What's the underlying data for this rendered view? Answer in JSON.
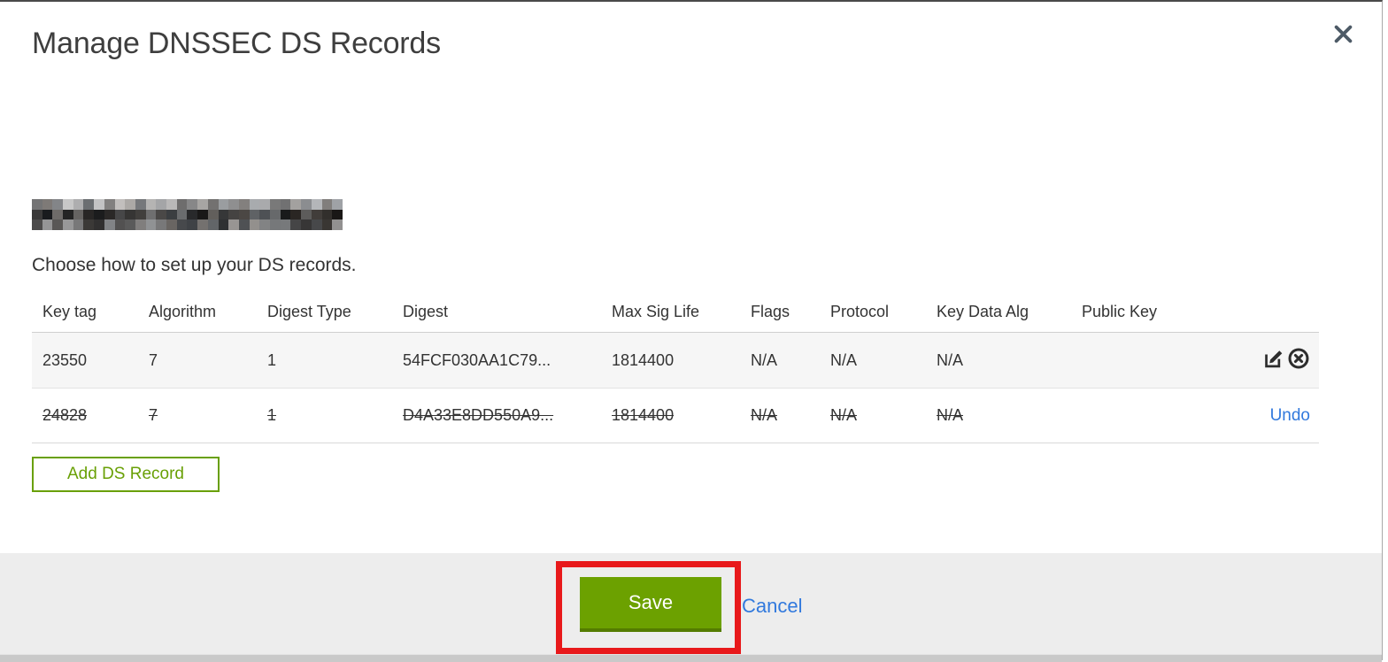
{
  "window": {
    "title": "Manage DNSSEC DS Records"
  },
  "content": {
    "instruction": "Choose how to set up your DS records.",
    "add_button_label": "Add DS Record",
    "domain_redacted": true
  },
  "table": {
    "columns": [
      "Key tag",
      "Algorithm",
      "Digest Type",
      "Digest",
      "Max Sig Life",
      "Flags",
      "Protocol",
      "Key Data Alg",
      "Public Key"
    ],
    "rows": [
      {
        "key_tag": "23550",
        "algorithm": "7",
        "digest_type": "1",
        "digest": "54FCF030AA1C79...",
        "max_sig_life": "1814400",
        "flags": "N/A",
        "protocol": "N/A",
        "key_data_alg": "N/A",
        "public_key": "",
        "state": "active",
        "actions": [
          "edit",
          "delete"
        ]
      },
      {
        "key_tag": "24828",
        "algorithm": "7",
        "digest_type": "1",
        "digest": "D4A33E8DD550A9...",
        "max_sig_life": "1814400",
        "flags": "N/A",
        "protocol": "N/A",
        "key_data_alg": "N/A",
        "public_key": "",
        "state": "deleted",
        "undo_label": "Undo"
      }
    ]
  },
  "footer": {
    "save_label": "Save",
    "cancel_label": "Cancel"
  },
  "colors": {
    "accent_green": "#69A006",
    "save_green": "#6CA100",
    "save_green_dark": "#547C00",
    "link_blue": "#3179DD",
    "annotation_red": "#E8191B",
    "row_gray": "#F6F6F6",
    "footer_gray": "#EDEDED"
  }
}
